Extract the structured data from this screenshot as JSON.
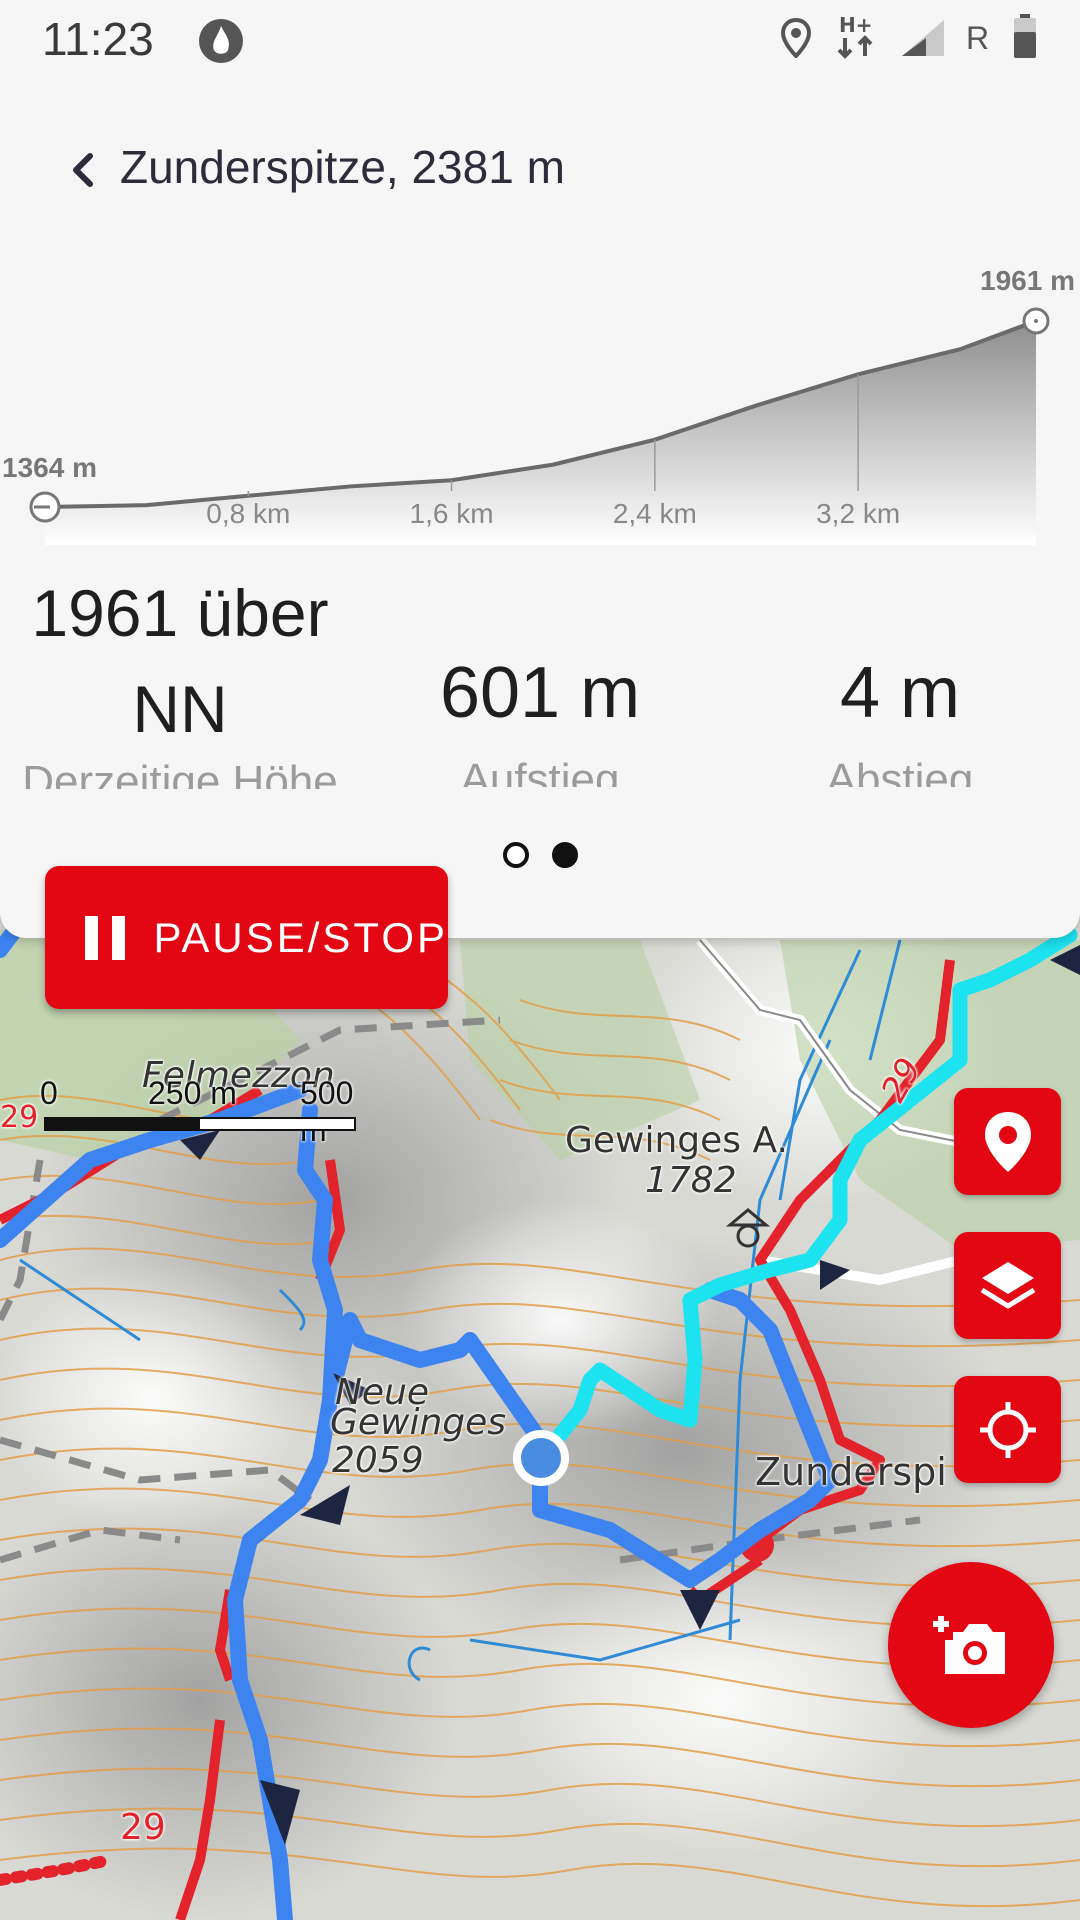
{
  "status_bar": {
    "time": "11:23",
    "network_label": "R",
    "icons": [
      "app-notification-icon",
      "location-pin-icon",
      "hplus-data-icon",
      "signal-icon",
      "battery-icon"
    ]
  },
  "header": {
    "title": "Zunderspitze, 2381 m"
  },
  "elevation_chart": {
    "max_label": "1961 m",
    "min_label": "1364 m",
    "ticks": [
      "0,8 km",
      "1,6 km",
      "2,4 km",
      "3,2 km"
    ]
  },
  "chart_data": {
    "type": "area",
    "x": [
      0,
      0.4,
      0.8,
      1.2,
      1.6,
      2.0,
      2.4,
      2.8,
      3.2,
      3.6,
      3.9
    ],
    "y": [
      1364,
      1370,
      1400,
      1430,
      1450,
      1500,
      1580,
      1690,
      1790,
      1870,
      1961
    ],
    "xlabel": "",
    "ylabel": "",
    "ylim": [
      1364,
      1961
    ],
    "grid": false
  },
  "stats": [
    {
      "value": "1961 über NN",
      "label": "Derzeitige Höhe"
    },
    {
      "value": "601 m",
      "label": "Aufstieg"
    },
    {
      "value": "4 m",
      "label": "Abstieg"
    }
  ],
  "pager": {
    "count": 2,
    "active": 1
  },
  "controls": {
    "pause_label": "PAUSE/STOP"
  },
  "map": {
    "labels": {
      "felmezzon": "Felmezzon",
      "gewinges_a": "Gewinges A.",
      "gewinges_a_alt": "1782",
      "neue": "Neue",
      "gewinges": "Gewinges",
      "gewinges_alt": "2059",
      "zunderspitze": "Zunderspi",
      "trail_29_a": "29",
      "trail_29_b": "29",
      "trail_29_c": "29"
    },
    "scale": {
      "zero": "0",
      "mid": "250 m",
      "end": "500 m"
    },
    "colors": {
      "accent": "#e30613",
      "route": "#3d84f0",
      "track": "#1de2f0",
      "trail": "#e3232b",
      "contour": "#e0a04a"
    }
  }
}
